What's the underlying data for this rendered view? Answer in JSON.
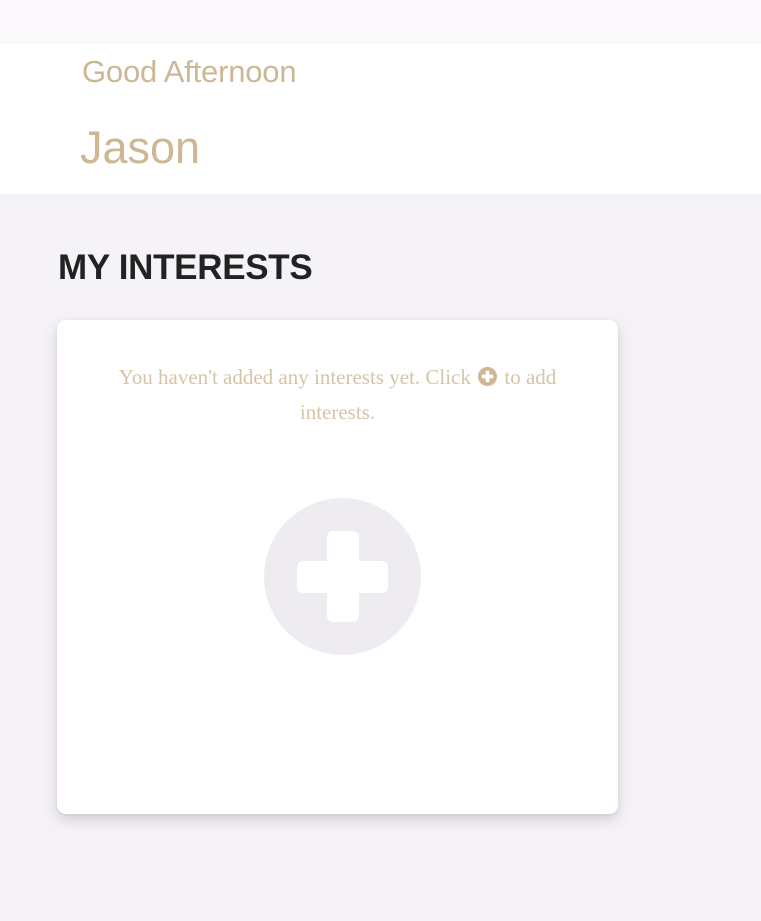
{
  "header": {
    "greeting": "Good Afternoon",
    "user_name": "Jason"
  },
  "interests": {
    "section_title": "MY INTERESTS",
    "empty_message_before_icon": "You haven't added any interests yet. Click",
    "empty_message_after_icon": "to add interests.",
    "inline_icon": "plus-circle-icon",
    "add_button_icon": "plus-icon"
  },
  "colors": {
    "accent_text": "#cdb794",
    "page_background": "#f6f3f8",
    "title_text": "#222222",
    "add_button_fill": "#efecf1"
  }
}
